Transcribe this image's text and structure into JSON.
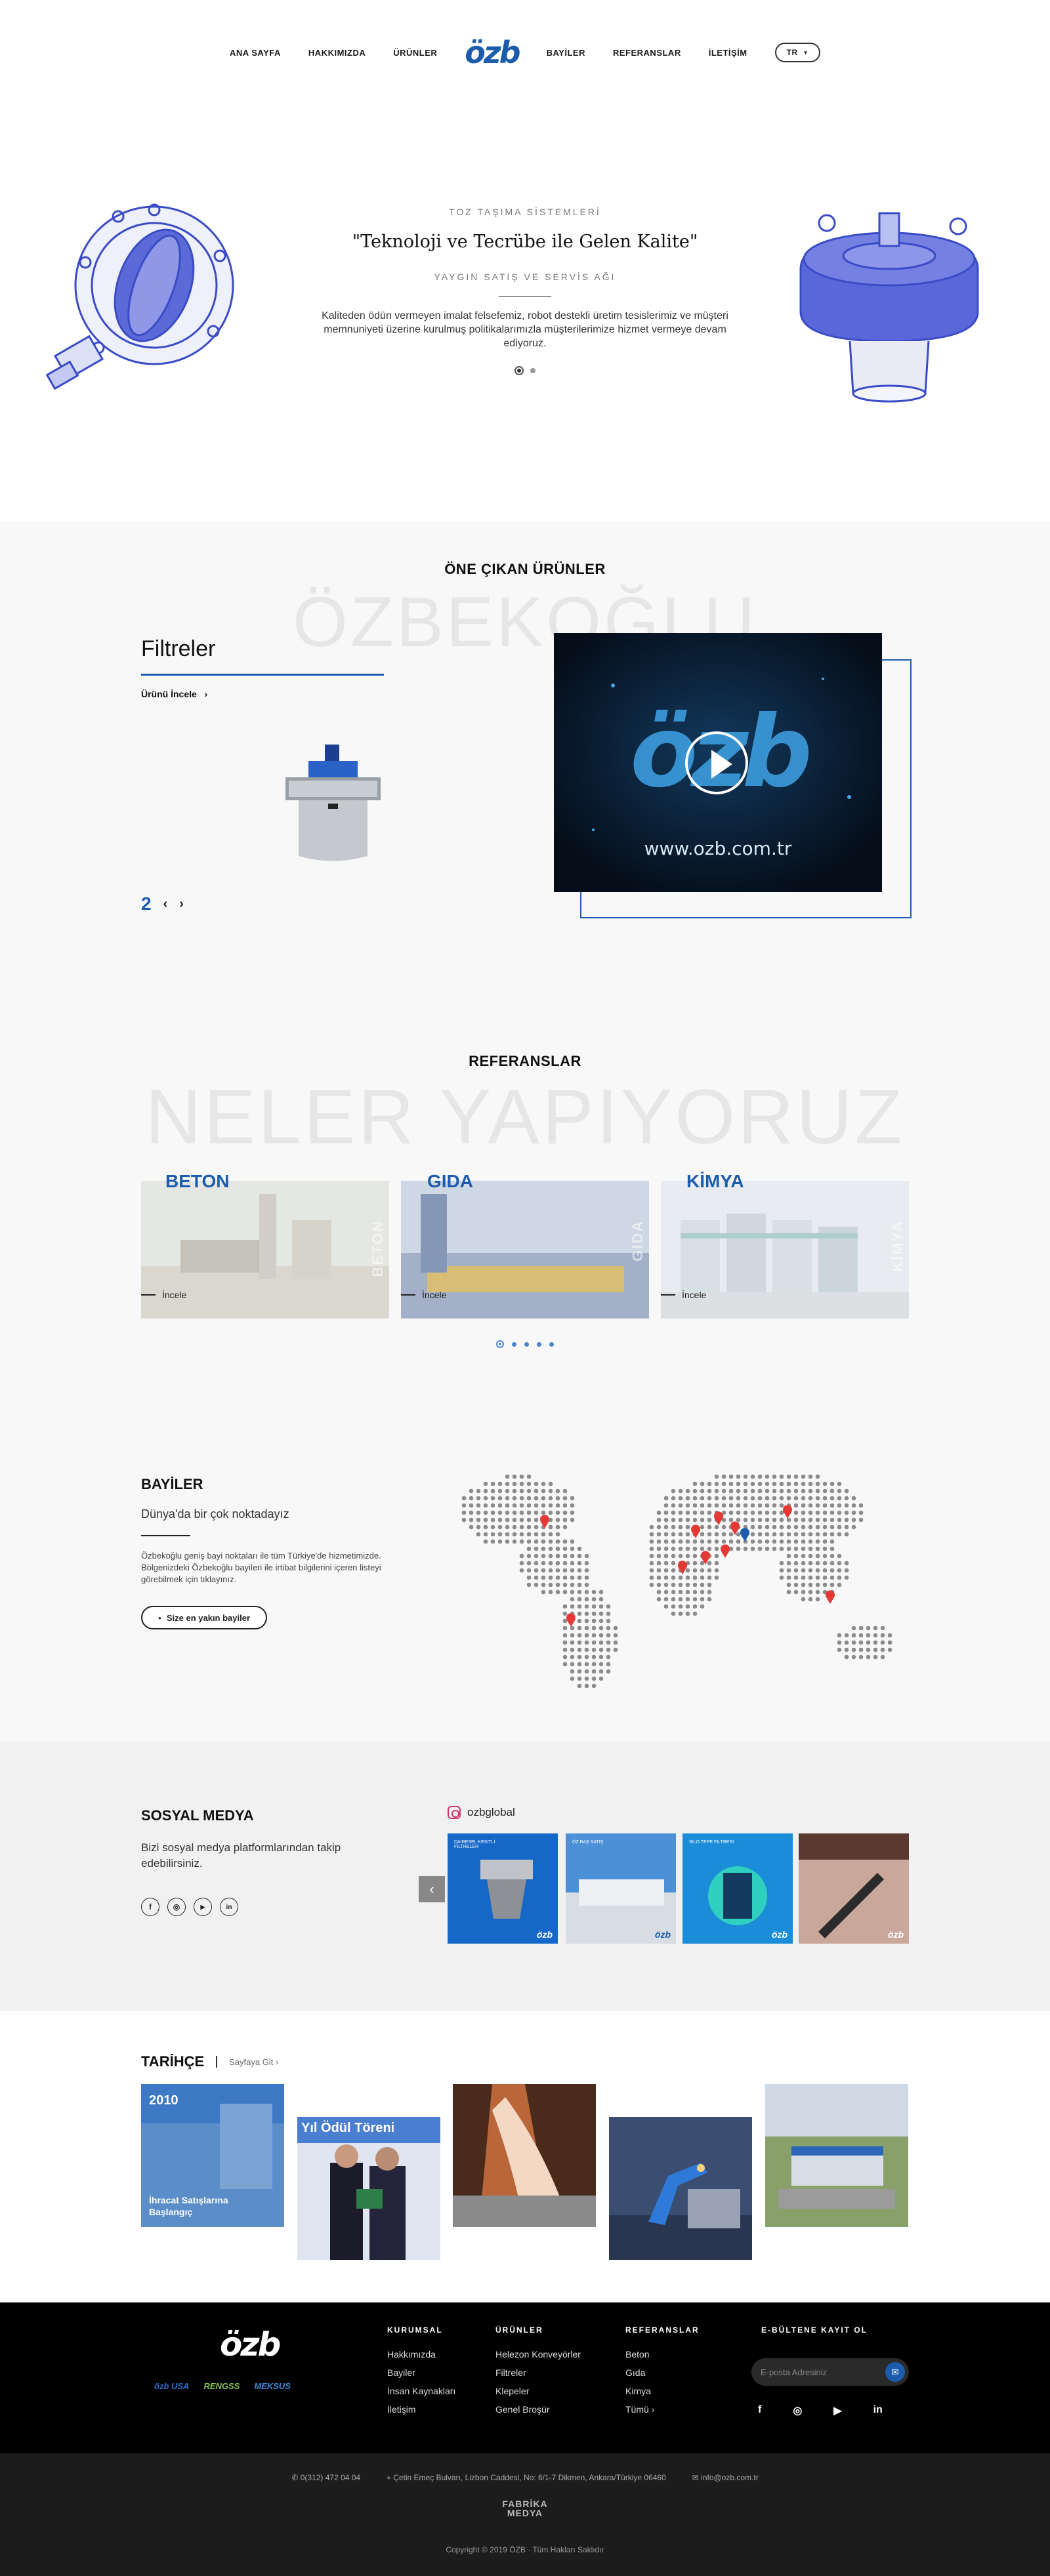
{
  "nav": {
    "left": [
      "ANA SAYFA",
      "HAKKIMIZDA",
      "ÜRÜNLER"
    ],
    "logo": "özb",
    "right": [
      "BAYİLER",
      "REFERANSLAR",
      "İLETİŞİM"
    ],
    "lang": "TR"
  },
  "hero": {
    "kicker": "TOZ TAŞIMA SİSTEMLERİ",
    "title": "\"Teknoloji ve Tecrübe ile Gelen Kalite\"",
    "subtitle": "YAYGIN SATIŞ VE SERVİS AĞI",
    "text": "Kaliteden ödün vermeyen imalat felsefemiz, robot destekli üretim tesislerimiz ve müşteri memnuniyeti üzerine kurulmuş politikalarımızla müşterilerimize hizmet vermeye devam ediyoruz."
  },
  "products": {
    "title": "ÖNE ÇIKAN ÜRÜNLER",
    "watermark": "ÖZBEKOĞLU",
    "name": "Filtreler",
    "link": "Ürünü İncele",
    "page": "2",
    "prev": "‹",
    "next": "›",
    "video_url": "www.ozb.com.tr",
    "video_logo": "özb"
  },
  "references": {
    "title": "REFERANSLAR",
    "watermark": "NELER YAPIYORUZ",
    "link": "İncele",
    "items": [
      {
        "name": "BETON",
        "vert": "BETON"
      },
      {
        "name": "GIDA",
        "vert": "GIDA"
      },
      {
        "name": "KİMYA",
        "vert": "KİMYA"
      }
    ]
  },
  "dealers": {
    "title": "BAYİLER",
    "subtitle": "Dünya'da bir çok noktadayız",
    "text": "Özbekoğlu geniş bayi noktaları ile tüm Türkiye'de hizmetimizde. Bölgenizdeki Özbekoğlu bayileri ile irtibat bilgilerini içeren listeyi görebilmek için tıklayınız.",
    "button": "Size en yakın bayiler"
  },
  "social": {
    "title": "SOSYAL MEDYA",
    "text": "Bizi sosyal medya platformlarından takip edebilirsiniz.",
    "icons": [
      "f",
      "◎",
      "▶",
      "in"
    ],
    "handle": "ozbglobal",
    "posts": [
      {
        "caption": "DAIRESEL KESİTLİ FİLTRELER",
        "mark": "özb"
      },
      {
        "caption": "ÖZ BAŞ SATIŞ",
        "mark": "özb"
      },
      {
        "caption": "SİLO TEPE FİLTRESİ",
        "mark": "özb"
      },
      {
        "caption": "",
        "mark": "özb"
      }
    ]
  },
  "history": {
    "title": "TARİHÇE",
    "link": "Sayfaya Git ›",
    "first": {
      "year": "2010",
      "caption": "İhracat Satışlarına Başlangıç"
    },
    "banner": "Yıl Ödül Töreni"
  },
  "footer": {
    "logo": "özb",
    "brands": [
      "özb USA",
      "RENGSS",
      "MEKSUS"
    ],
    "cols": [
      {
        "title": "KURUMSAL",
        "items": [
          "Hakkımızda",
          "Bayiler",
          "İnsan Kaynakları",
          "İletişim"
        ]
      },
      {
        "title": "ÜRÜNLER",
        "items": [
          "Helezon Konveyörler",
          "Filtreler",
          "Klepeler",
          "Genel Broşür"
        ]
      },
      {
        "title": "REFERANSLAR",
        "items": [
          "Beton",
          "Gıda",
          "Kimya",
          "Tümü ›"
        ]
      }
    ],
    "newsletter_title": "E-BÜLTENE KAYIT OL",
    "email_placeholder": "E-posta Adresiniz",
    "social": [
      "f",
      "◎",
      "▶",
      "in"
    ]
  },
  "subfooter": {
    "phone": "0(312) 472 04 04",
    "address": "Çetin Emeç Bulvarı, Lizbon Caddesi, No: 6/1-7 Dikmen, Ankara/Türkiye 06460",
    "email": "info@ozb.com.tr",
    "agency": "FABRİKA\nMEDYA",
    "copyright": "Copyright © 2019 ÖZB  ·  Tüm Hakları Saklıdır"
  },
  "colors": {
    "brand_blue": "#1c5cad",
    "footer_bg": "#000000"
  }
}
